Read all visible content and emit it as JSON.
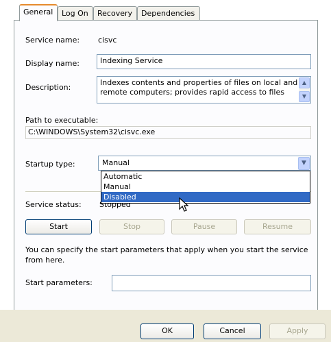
{
  "tabs": [
    {
      "label": "General",
      "active": true
    },
    {
      "label": "Log On",
      "active": false
    },
    {
      "label": "Recovery",
      "active": false
    },
    {
      "label": "Dependencies",
      "active": false
    }
  ],
  "general": {
    "service_name_label": "Service name:",
    "service_name_value": "cisvc",
    "display_name_label": "Display name:",
    "display_name_value": "Indexing Service",
    "description_label": "Description:",
    "description_line1": "Indexes contents and properties of files on local and",
    "description_line2": "remote computers; provides rapid access to files",
    "path_label": "Path to executable:",
    "path_value": "C:\\WINDOWS\\System32\\cisvc.exe",
    "startup_type_label": "Startup type:",
    "startup_type_value": "Manual",
    "startup_options": [
      "Automatic",
      "Manual",
      "Disabled"
    ],
    "startup_highlighted": "Disabled",
    "service_status_label": "Service status:",
    "service_status_value": "Stopped"
  },
  "service_buttons": {
    "start": "Start",
    "stop": "Stop",
    "pause": "Pause",
    "resume": "Resume"
  },
  "hint_line1": "You can specify the start parameters that apply when you start the service",
  "hint_line2": "from here.",
  "start_params_label": "Start parameters:",
  "start_params_value": "",
  "dialog_buttons": {
    "ok": "OK",
    "cancel": "Cancel",
    "apply": "Apply"
  },
  "colors": {
    "selection": "#316ac5",
    "tab_accent": "#e68b2c",
    "dialog_bg": "#ece9d8"
  }
}
